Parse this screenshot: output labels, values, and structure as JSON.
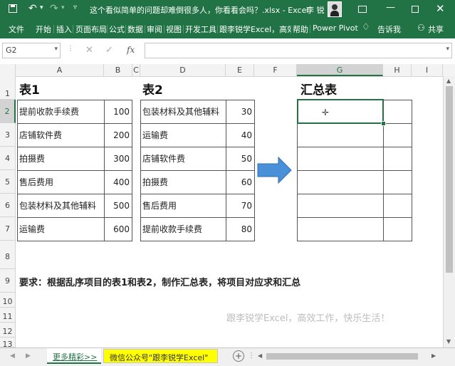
{
  "window": {
    "title": "这个看似简单的问题却难倒很多人，你看看会吗？.xlsx - Excel",
    "user": "李 锐"
  },
  "ribbon": {
    "tabs": [
      "文件",
      "开始",
      "插入",
      "页面布局",
      "公式",
      "数据",
      "审阅",
      "视图",
      "开发工具",
      "跟李锐学Excel，高效工",
      "帮助",
      "Power Pivot"
    ],
    "tell_me": "告诉我",
    "share": "共享"
  },
  "formula_bar": {
    "name_box": "G2",
    "fx": "fx",
    "value": ""
  },
  "columns": [
    "A",
    "B",
    "C",
    "D",
    "E",
    "F",
    "G",
    "H",
    "I"
  ],
  "rows": [
    "1",
    "2",
    "3",
    "4",
    "5",
    "6",
    "7",
    "8",
    "9",
    "10",
    "11",
    "12",
    "13"
  ],
  "table1": {
    "title": "表1",
    "rows": [
      {
        "item": "提前收款手续费",
        "value": "100"
      },
      {
        "item": "店铺软件费",
        "value": "200"
      },
      {
        "item": "拍摄费",
        "value": "300"
      },
      {
        "item": "售后费用",
        "value": "400"
      },
      {
        "item": "包装材料及其他辅料",
        "value": "500"
      },
      {
        "item": "运输费",
        "value": "600"
      }
    ]
  },
  "table2": {
    "title": "表2",
    "rows": [
      {
        "item": "包装材料及其他辅料",
        "value": "30"
      },
      {
        "item": "运输费",
        "value": "40"
      },
      {
        "item": "店铺软件费",
        "value": "50"
      },
      {
        "item": "拍摄费",
        "value": "60"
      },
      {
        "item": "售后费用",
        "value": "70"
      },
      {
        "item": "提前收款手续费",
        "value": "80"
      }
    ]
  },
  "summary": {
    "title": "汇总表"
  },
  "requirement": "要求：根据乱序项目的表1和表2，制作汇总表，将项目对应求和汇总",
  "watermark": "跟李锐学Excel，高效工作，快乐生活！",
  "sheets": [
    {
      "label": "更多精彩>>"
    },
    {
      "label": "微信公众号\"跟李锐学Excel\""
    }
  ],
  "colors": {
    "excel_green": "#217346",
    "arrow_blue": "#4a90d9",
    "sheet_tab_yellow": "#ffff00"
  }
}
